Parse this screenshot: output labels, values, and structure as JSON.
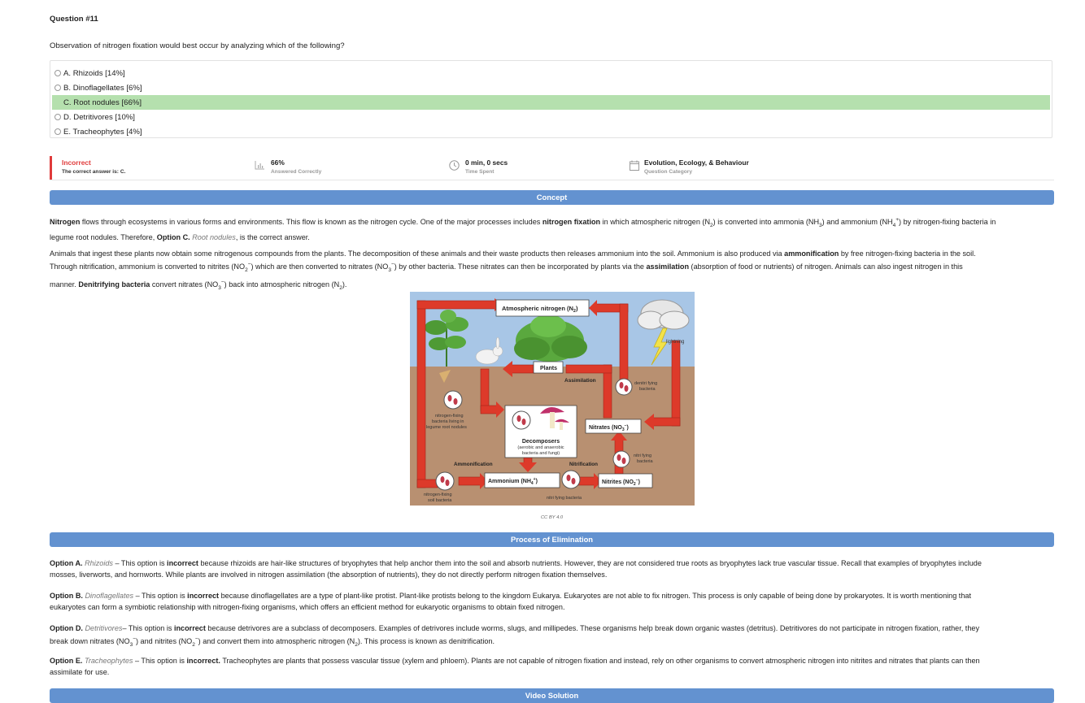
{
  "question": {
    "title": "Question #11",
    "stem": "Observation of nitrogen fixation would best occur by analyzing which of the following?",
    "options": [
      {
        "label": "A. Rhizoids [14%]",
        "correct": false
      },
      {
        "label": "B. Dinoflagellates [6%]",
        "correct": false
      },
      {
        "label": "C. Root nodules [66%]",
        "correct": true
      },
      {
        "label": "D. Detritivores [10%]",
        "correct": false
      },
      {
        "label": "E. Tracheophytes [4%]",
        "correct": false
      }
    ]
  },
  "stats": {
    "result": "Incorrect",
    "result_sub": "The correct answer is: C.",
    "percent": "66%",
    "percent_sub": "Answered Correctly",
    "time": "0 min, 0 secs",
    "time_sub": "Time Spent",
    "category": "Evolution, Ecology, & Behaviour",
    "category_sub": "Question Category"
  },
  "sections": {
    "concept": "Concept",
    "elimination": "Process of Elimination",
    "video": "Video Solution"
  },
  "concept": {
    "p1": {
      "t1": "Nitrogen",
      "t2": " flows through ecosystems in various forms and environments. This flow is known as the nitrogen cycle. One of the major processes includes ",
      "t3": "nitrogen fixation",
      "t4": " in which atmospheric nitrogen (N",
      "t5": "2",
      "t6": ") is converted into ammonia (NH",
      "t7": "3",
      "t8": ") and ammonium (NH",
      "t9": "4",
      "t10": "+",
      "t11": ") by nitrogen-fixing bacteria in",
      "t12": "legume root nodules. Therefore, ",
      "t13": "Option C.",
      "t14": "Root nodules",
      "t15": ", is the correct answer."
    },
    "p2": {
      "l1a": "Animals that ingest these plants now obtain some nitrogenous compounds from the plants. The decomposition of these animals and their waste products then releases ammonium into the soil. Ammonium is also produced via ",
      "l1b": "ammonification",
      "l1c": " by free nitrogen-fixing bacteria in the soil.",
      "l2a": "Through nitrification, ammonium is converted to nitrites (NO",
      "l2b": "2",
      "l2c": "−",
      "l2d": ") which are then converted to nitrates (NO",
      "l2e": "3",
      "l2f": "−",
      "l2g": ") by other bacteria. These nitrates can then be incorporated by plants via the ",
      "l2h": "assimilation",
      "l2i": " (absorption of food or nutrients) of nitrogen. Animals can also ingest nitrogen in this",
      "l3a": "manner. ",
      "l3b": "Denitrifying bacteria",
      "l3c": " convert nitrates (NO",
      "l3d": "3",
      "l3e": "−",
      "l3f": ") back into atmospheric nitrogen (N",
      "l3g": "2",
      "l3h": ")."
    }
  },
  "diagram": {
    "atm": "Atmospheric nitrogen (N",
    "atm_sub": "2",
    "atm_end": ")",
    "lightning": "lightning",
    "plants": "Plants",
    "assimilation": "Assimilation",
    "denitrifying": "denitri fying",
    "denitrifying2": "bacteria",
    "nfix_root1": "nitrogen-fixing",
    "nfix_root2": "bacteria living in",
    "nfix_root3": "legume root nodules",
    "decomposers": "Decomposers",
    "decomp2": "(aerobic and anaerobic",
    "decomp3": "bacteria and fungi)",
    "nitrates": "Nitrates (NO",
    "nitrates_sub": "3",
    "nitrates_sup": "−",
    "nitrates_end": ")",
    "nitrifying": "nitri fying",
    "nitrifying2": "bacteria",
    "ammonification": "Ammonification",
    "nitrification": "Nitrification",
    "ammonium": "Ammonium (NH",
    "ammonium_sub": "4",
    "ammonium_sup": "+",
    "ammonium_end": ")",
    "nitrites": "Nitrites (NO",
    "nitrites_sub": "2",
    "nitrites_sup": "−",
    "nitrites_end": ")",
    "soil_bact1": "nitrogen-fixing",
    "soil_bact2": "soil bacteria",
    "nitrifying_bottom": "nitri fying bacteria",
    "credit": "CC BY 4.0"
  },
  "elimination": {
    "a": {
      "opt": "Option A.",
      "name": "Rhizoids",
      "t1": " – This option is ",
      "inc": "incorrect",
      "l1": " because rhizoids are hair-like structures of bryophytes that help anchor them into the soil and absorb nutrients. However, they are not considered true roots as bryophytes lack true vascular tissue. Recall that examples of bryophytes include",
      "l2": "mosses, liverworts, and hornworts. While plants are involved in nitrogen assimilation (the absorption of nutrients), they do not directly perform nitrogen fixation themselves."
    },
    "b": {
      "opt": "Option B.",
      "name": "Dinoflagellates",
      "t1": " – This option is ",
      "inc": "incorrect",
      "l1": " because dinoflagellates are a type of plant-like protist. Plant-like protists belong to the kingdom Eukarya. Eukaryotes are not able to fix nitrogen. This process is only capable of being done by prokaryotes. It is worth mentioning that",
      "l2": "eukaryotes can form a symbiotic relationship with nitrogen-fixing organisms, which offers an efficient method for eukaryotic organisms to obtain fixed nitrogen."
    },
    "d": {
      "opt": "Option D.",
      "name": "Detritivores",
      "t1": "– This option is ",
      "inc": "incorrect",
      "l1": " because detrivores are a subclass of decomposers. Examples of detrivores include worms, slugs, and millipedes. These organisms help break down organic wastes (detritus). Detritivores do not participate in nitrogen fixation, rather, they",
      "l2a": "break down nitrates (NO",
      "l2b": "3",
      "l2c": "−",
      "l2d": ") and nitrites (NO",
      "l2e": "2",
      "l2f": "−",
      "l2g": ") and convert them into atmospheric nitrogen (N",
      "l2h": "2",
      "l2i": "). This process is known as denitrification."
    },
    "e": {
      "opt": "Option E.",
      "name": "Tracheophytes",
      "t1": " – This option is ",
      "inc": "incorrect.",
      "l1": "  Tracheophytes are plants that possess vascular tissue (xylem and phloem). Plants are not capable of nitrogen fixation and instead, rely on other organisms to convert atmospheric nitrogen into nitrites and nitrates that plants can then",
      "l2": "assimilate for use."
    }
  }
}
